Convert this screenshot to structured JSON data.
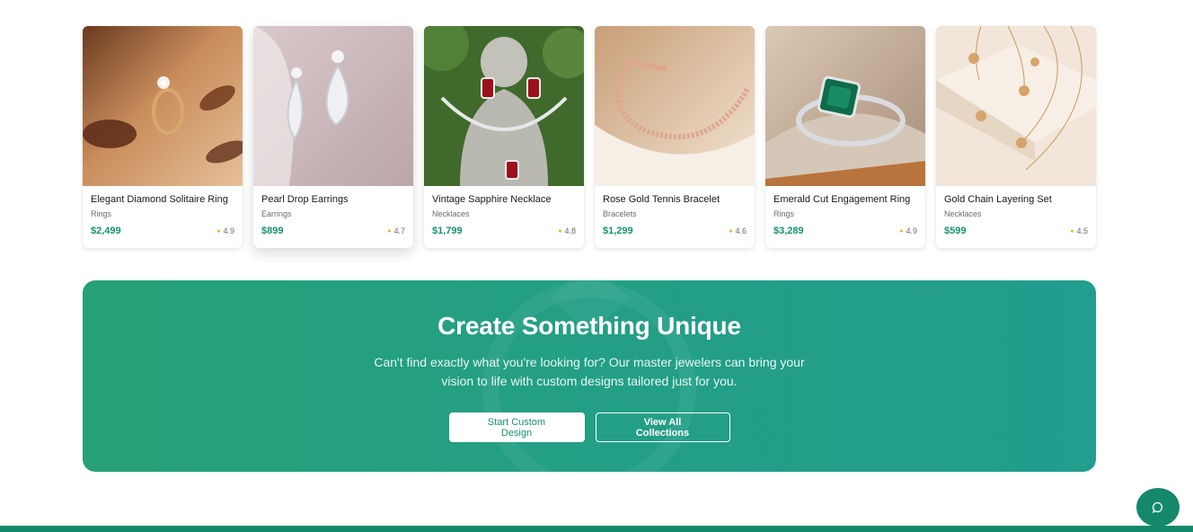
{
  "products": [
    {
      "name": "Elegant Diamond Solitaire Ring",
      "category": "Rings",
      "price": "$2,499",
      "rating": "4.9",
      "image_icon": "diamond-ring-image"
    },
    {
      "name": "Pearl Drop Earrings",
      "category": "Earrings",
      "price": "$899",
      "rating": "4.7",
      "image_icon": "drop-earrings-image"
    },
    {
      "name": "Vintage Sapphire Necklace",
      "category": "Necklaces",
      "price": "$1,799",
      "rating": "4.8",
      "image_icon": "gem-necklace-image"
    },
    {
      "name": "Rose Gold Tennis Bracelet",
      "category": "Bracelets",
      "price": "$1,299",
      "rating": "4.6",
      "image_icon": "tennis-bracelet-image"
    },
    {
      "name": "Emerald Cut Engagement Ring",
      "category": "Rings",
      "price": "$3,289",
      "rating": "4.9",
      "image_icon": "emerald-ring-image"
    },
    {
      "name": "Gold Chain Layering Set",
      "category": "Necklaces",
      "price": "$599",
      "rating": "4.5",
      "image_icon": "gold-chains-image"
    }
  ],
  "banner": {
    "title": "Create Something Unique",
    "description": "Can't find exactly what you're looking for? Our master jewelers can bring your vision to life with custom designs tailored just for you.",
    "primary_button": "Start Custom Design",
    "secondary_button": "View All Collections"
  },
  "colors": {
    "accent": "#15936c",
    "banner_start": "#25a077",
    "banner_end": "#229d8e",
    "star": "#f2b01e",
    "footer": "#14896a"
  },
  "icons": {
    "chat": "chat-bubble-icon",
    "star": "star-icon"
  }
}
